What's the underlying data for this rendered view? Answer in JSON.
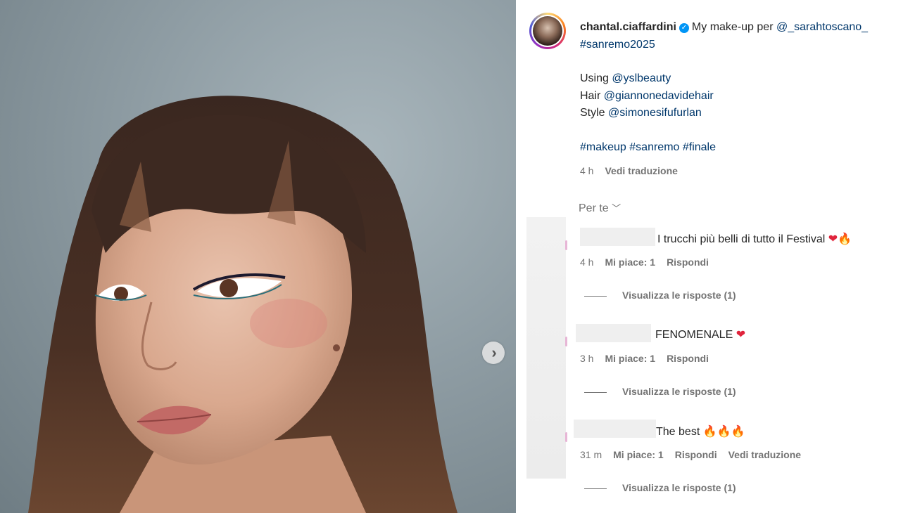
{
  "post": {
    "username": "chantal.ciaffardini",
    "caption_intro": "My make-up per",
    "mention_main": "@_sarahtoscano_",
    "hashtag_main": "#sanremo2025",
    "using_label": "Using",
    "using_mention": "@yslbeauty",
    "hair_label": "Hair",
    "hair_mention": "@giannonedavidehair",
    "style_label": "Style",
    "style_mention": "@simonesifufurlan",
    "hashtags": "#makeup #sanremo #finale",
    "time": "4 h",
    "translate": "Vedi traduzione"
  },
  "sort": {
    "label": "Per te",
    "icon": "chevron-down-icon"
  },
  "comments": [
    {
      "text": "I trucchi più belli di tutto il Festival",
      "emoji": [
        "heart",
        "fire"
      ],
      "time": "4 h",
      "likes": "Mi piace: 1",
      "reply": "Rispondi",
      "view_replies": "Visualizza le risposte (1)"
    },
    {
      "text": "FENOMENALE",
      "emoji": [
        "heart"
      ],
      "time": "3 h",
      "likes": "Mi piace: 1",
      "reply": "Rispondi",
      "view_replies": "Visualizza le risposte (1)"
    },
    {
      "text": "The best",
      "emoji": [
        "fire",
        "fire",
        "fire"
      ],
      "time": "31 m",
      "likes": "Mi piace: 1",
      "reply": "Rispondi",
      "translate": "Vedi traduzione",
      "view_replies": "Visualizza le risposte (1)"
    }
  ],
  "colors": {
    "link": "#00376b",
    "verified": "#0095f6",
    "meta": "#737373",
    "heart": "#e0243c"
  }
}
